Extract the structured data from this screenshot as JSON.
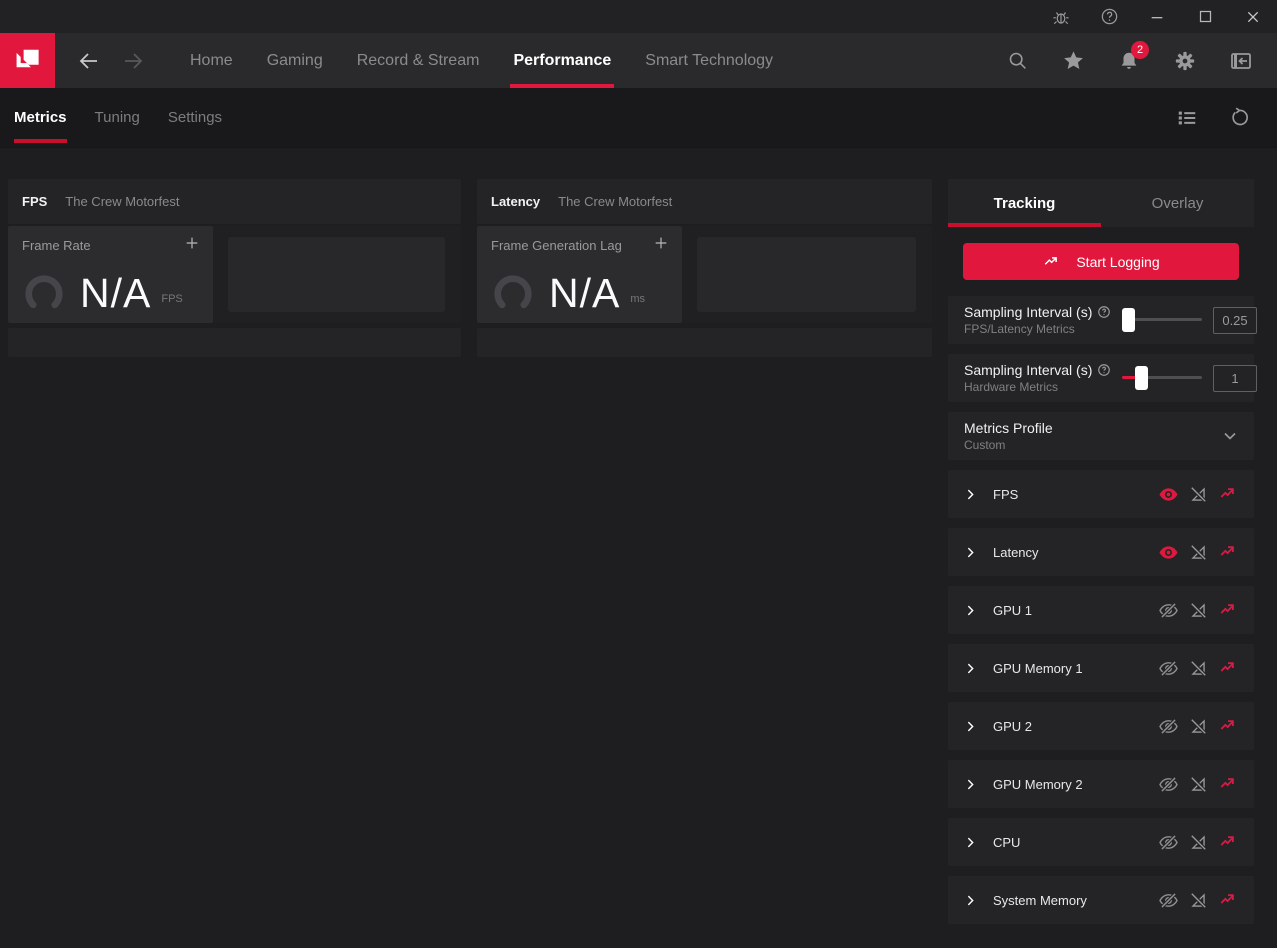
{
  "colors": {
    "accent": "#e2173d",
    "underline": "#c8102e",
    "bg": "#1e1e20",
    "panel": "#242427"
  },
  "titlebar": {
    "icons": [
      "bug",
      "help",
      "minimize",
      "maximize",
      "close"
    ]
  },
  "nav": {
    "items": [
      {
        "label": "Home"
      },
      {
        "label": "Gaming"
      },
      {
        "label": "Record & Stream"
      },
      {
        "label": "Performance"
      },
      {
        "label": "Smart Technology"
      }
    ],
    "active": "Performance",
    "notification_count": "2"
  },
  "subnav": {
    "items": [
      {
        "label": "Metrics"
      },
      {
        "label": "Tuning"
      },
      {
        "label": "Settings"
      }
    ],
    "active": "Metrics"
  },
  "panels": {
    "fps": {
      "title": "FPS",
      "subtitle": "The Crew Motorfest",
      "metric_label": "Frame Rate",
      "value": "N/A",
      "unit": "FPS"
    },
    "latency": {
      "title": "Latency",
      "subtitle": "The Crew Motorfest",
      "metric_label": "Frame Generation Lag",
      "value": "N/A",
      "unit": "ms"
    }
  },
  "sidebar": {
    "tabs": [
      {
        "label": "Tracking"
      },
      {
        "label": "Overlay"
      }
    ],
    "active_tab": "Tracking",
    "start_logging_label": "Start Logging",
    "settings": [
      {
        "label": "Sampling Interval (s)",
        "sublabel": "FPS/Latency Metrics",
        "value": "0.25"
      },
      {
        "label": "Sampling Interval (s)",
        "sublabel": "Hardware Metrics",
        "value": "1"
      },
      {
        "label": "Metrics Profile",
        "sublabel": "Custom"
      }
    ],
    "metrics": [
      {
        "label": "FPS",
        "visible": true
      },
      {
        "label": "Latency",
        "visible": true
      },
      {
        "label": "GPU 1",
        "visible": false
      },
      {
        "label": "GPU Memory 1",
        "visible": false
      },
      {
        "label": "GPU 2",
        "visible": false
      },
      {
        "label": "GPU Memory 2",
        "visible": false
      },
      {
        "label": "CPU",
        "visible": false
      },
      {
        "label": "System Memory",
        "visible": false
      }
    ]
  }
}
